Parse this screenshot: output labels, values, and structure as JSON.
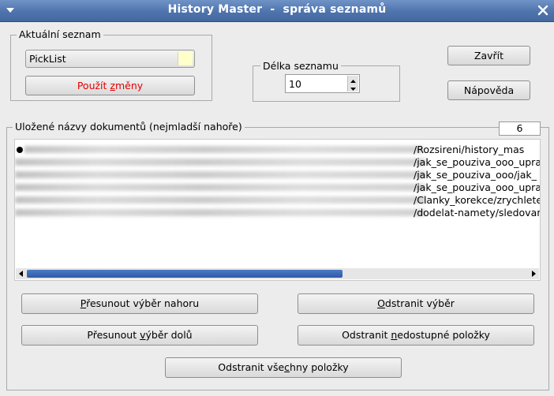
{
  "window": {
    "title": "History Master  -  správa seznamů"
  },
  "current_list": {
    "group_label": "Aktuální seznam",
    "selected_value": "PickList",
    "apply_label_pre": "Použít ",
    "apply_label_acc": "z",
    "apply_label_post": "měny"
  },
  "list_length": {
    "group_label": "Délka seznamu",
    "value": "10"
  },
  "buttons": {
    "close": "Zavřít",
    "help": "Nápověda"
  },
  "saved": {
    "group_label": "Uložené názvy dokumentů (nejmladší nahoře)",
    "count": "6",
    "items": [
      "/Rozsireni/history_mas",
      "/jak_se_pouziva_ooo_upra",
      "/jak_se_pouziva_ooo/jak_",
      "/jak_se_pouziva_ooo_upra",
      "/Clanky_korekce/zrychlete",
      "/dodelat-namety/sledovan"
    ],
    "scroll_fraction": 0.63
  },
  "actions": {
    "move_up": {
      "acc": "P",
      "rest": "řesunout výběr nahoru"
    },
    "remove_sel": {
      "acc": "O",
      "rest": "dstranit výběr"
    },
    "move_down": {
      "pre": "Přesunout ",
      "acc": "v",
      "rest": "ýběr dolů"
    },
    "remove_unavail": {
      "pre": "Odstranit ",
      "acc": "n",
      "rest": "edostupné položky"
    },
    "remove_all": {
      "pre": "Odstranit vše",
      "acc": "c",
      "rest": "hny položky"
    }
  },
  "colors": {
    "title_bar": "#4f74ad",
    "accent": "#2c5aa6",
    "warning_text": "#e00000"
  }
}
